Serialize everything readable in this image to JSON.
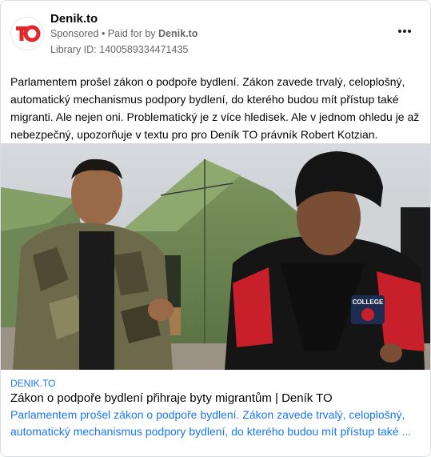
{
  "ad": {
    "page_name": "Denik.to",
    "sponsored_label": "Sponsored",
    "bullet": " • ",
    "paid_for_prefix": "Paid for by ",
    "paid_for_name": "Denik.to",
    "library_id": "Library ID: 1400589334471435",
    "body_text": "Parlamentem prošel zákon o podpoře bydlení. Zákon zavede trvalý, celoplošný, automatický mechanismus podpory bydlení, do kterého budou mít přístup také migranti. Ale nejen oni. Problematický je z více hledisek. Ale v jednom ohledu je až nebezpečný, upozorňuje v textu pro pro Deník TO právník Robert Kotzian.",
    "logo_letters": "TO",
    "photo_print_text": "COLLEGE"
  },
  "link": {
    "domain": "DENIK.TO",
    "title": "Zákon o podpoře bydlení přihraje byty migrantům | Deník TO",
    "description": "Parlamentem prošel zákon o podpoře bydlení. Zákon zavede trvalý, celoplošný, automatický mechanismus podpory bydlení, do kterého budou mít přístup také ..."
  },
  "icons": {
    "more": "more-horizontal-icon",
    "logo": "denik-to-logo"
  },
  "colors": {
    "brand_red": "#e3262b",
    "link_blue": "#1877f2",
    "secondary_text": "#65676b"
  }
}
